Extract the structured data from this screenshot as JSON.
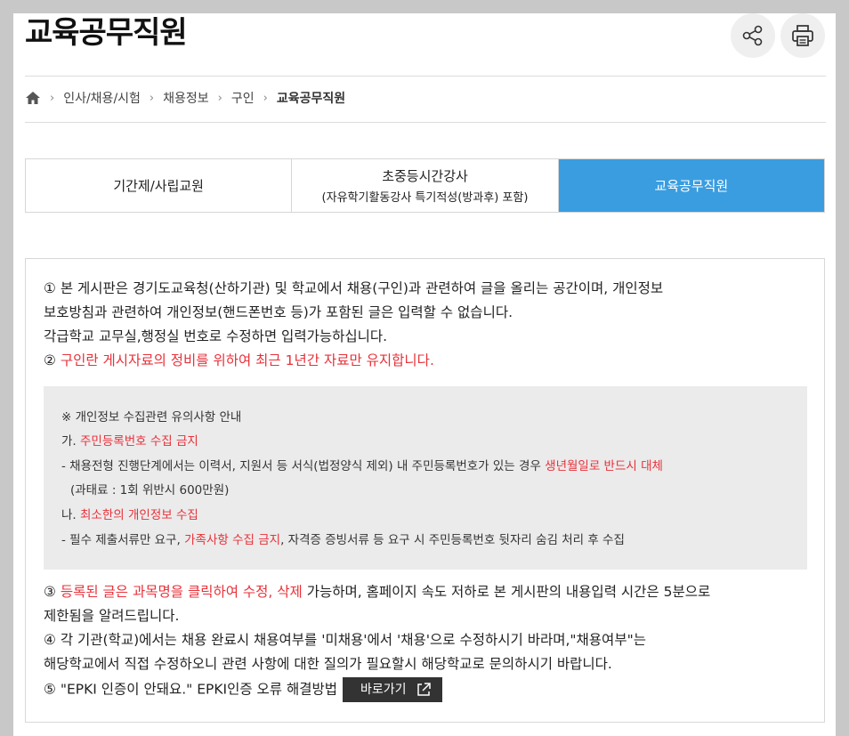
{
  "page": {
    "title": "교육공무직원"
  },
  "actions": {
    "share_icon": "share-icon",
    "print_icon": "printer-icon"
  },
  "breadcrumb": {
    "home_icon": "home-icon",
    "items": [
      "인사/채용/시험",
      "채용정보",
      "구인",
      "교육공무직원"
    ]
  },
  "tabs": [
    {
      "label": "기간제/사립교원",
      "sub": ""
    },
    {
      "label": "초중등시간강사",
      "sub": "(자유학기활동강사 특기적성(방과후) 포함)"
    },
    {
      "label": "교육공무직원",
      "sub": "",
      "active": true
    }
  ],
  "notice": {
    "p1_l1": "① 본 게시판은 경기도교육청(산하기관) 및 학교에서 채용(구인)과 관련하여 글을 올리는 공간이며, 개인정보",
    "p1_l2": "보호방침과 관련하여 개인정보(핸드폰번호 등)가 포함된 글은 입력할 수 없습니다.",
    "p1_l3": "각급학교 교무실,행정실 번호로 수정하면 입력가능하십니다.",
    "p2_num": "② ",
    "p2_text": "구인란 게시자료의 정비를 위하여 최근 1년간 자료만 유지합니다.",
    "box": {
      "heading": "※ 개인정보 수집관련 유의사항 안내",
      "a_prefix": "가. ",
      "a_text": "주민등록번호 수집 금지",
      "a_detail": "- 채용전형 진행단계에서는 이력서, 지원서 등 서식(법정양식 제외) 내 주민등록번호가 있는 경우 ",
      "a_detail_red": "생년월일로 반드시 대체",
      "a_fine": "(과태료 : 1회 위반시 600만원)",
      "b_prefix": "나. ",
      "b_text": "최소한의 개인정보 수집",
      "b_detail_1": "- 필수 제출서류만 요구, ",
      "b_detail_red": "가족사항 수집 금지",
      "b_detail_2": ", 자격증 증빙서류 등 요구 시 주민등록번호 뒷자리 숨김 처리 후 수집"
    },
    "p3_num": "③ ",
    "p3_red": "등록된 글은 과목명을 클릭하여 수정, 삭제",
    "p3_text": " 가능하며, 홈페이지 속도 저하로 본 게시판의 내용입력 시간은 5분으로",
    "p3_l2": "제한됨을 알려드립니다.",
    "p4_l1": "④ 각 기관(학교)에서는 채용 완료시 채용여부를 '미채용'에서 '채용'으로 수정하시기 바라며,\"채용여부\"는",
    "p4_l2": "해당학교에서 직접 수정하오니 관련 사항에 대한 질의가 필요할시 해당학교로 문의하시기 바랍니다.",
    "p5_text": "⑤ \"EPKI 인증이 안돼요.\" EPKI인증 오류 해결방법",
    "p5_button": "바로가기",
    "p5_button_icon": "external-link-icon"
  },
  "colors": {
    "accent": "#3a9de0",
    "red": "#e8313a",
    "button_dark": "#333333"
  }
}
